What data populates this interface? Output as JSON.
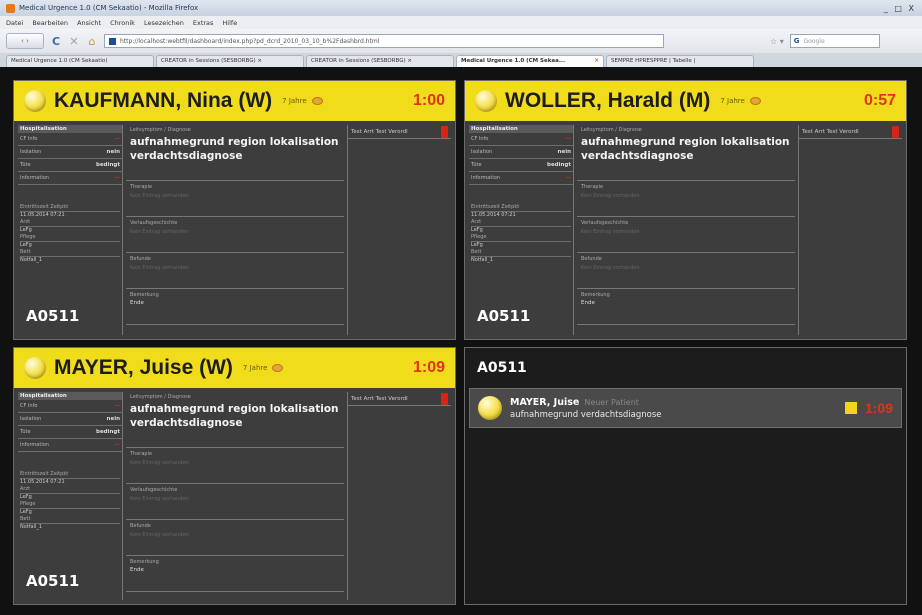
{
  "browser": {
    "title": "Medical Urgence 1.0 (CM Sekaatio) - Mozilla Firefox",
    "window_controls": "_ □ X",
    "menu": [
      "Datei",
      "Bearbeiten",
      "Ansicht",
      "Chronik",
      "Lesezeichen",
      "Extras",
      "Hilfe"
    ],
    "back_label": "‹ ›",
    "url": "http://localhost:webtfil/dashboard/index.php?pd_dcrd_2010_03_10_b%2Fdashbrd.html",
    "search_placeholder": "Google",
    "tabs": [
      {
        "label": "Medical Urgence 1.0 (CM Sekaatio)",
        "active": false
      },
      {
        "label": "CREATOR in Sessions (SESBORBG) ×",
        "active": false
      },
      {
        "label": "CREATOR in Sessions (SESBORBG) ×",
        "active": false
      },
      {
        "label": "Medical Urgence 1.0 (CM Sekaa...",
        "active": true
      },
      {
        "label": "SEMPRE HPRESPPRE | Tabelle |",
        "active": false
      }
    ]
  },
  "common": {
    "left_header": "Hospitalisation",
    "left_rows": [
      {
        "k": "CF Info",
        "v": "—"
      },
      {
        "k": "Isolation",
        "v": "nein"
      },
      {
        "k": "Tüte",
        "v": "bedingt"
      },
      {
        "k": "Information",
        "v": "—"
      }
    ],
    "small_blocks": [
      {
        "l": "Eintrittszeit Zeitpkt",
        "v": "11.05.2014 07:21"
      },
      {
        "l": "Arzt",
        "v": "LeFg"
      },
      {
        "l": "Pflege",
        "v": "LeFg"
      },
      {
        "l": "Bett",
        "v": "Notfall_1"
      }
    ],
    "mid_caption": "Leitsymptom / Diagnose",
    "diagnosis": "aufnahmegrund region lokalisation verdachtsdiagnose",
    "mid_sections": [
      {
        "cap": "Therapie",
        "ph": "Kein Eintrag vorhanden",
        "val": ""
      },
      {
        "cap": "Verlaufsgeschichte",
        "ph": "Kein Eintrag vorhanden",
        "val": ""
      },
      {
        "cap": "Befunde",
        "ph": "Kein Eintrag vorhanden",
        "val": ""
      },
      {
        "cap": "Bemerkung",
        "ph": "",
        "val": "Ende"
      }
    ],
    "right_header": "Test Arrt Test Verordl",
    "room": "A0511"
  },
  "patients": [
    {
      "name": "KAUFMANN, Nina (W)",
      "age": "7 Jahre",
      "timer": "1:00"
    },
    {
      "name": "WOLLER, Harald (M)",
      "age": "7 Jahre",
      "timer": "0:57"
    },
    {
      "name": "MAYER, Juise (W)",
      "age": "7 Jahre",
      "timer": "1:09"
    }
  ],
  "overview": {
    "room": "A0511",
    "entry_name": "MAYER, Juise",
    "entry_tag": "Neuer Patient",
    "entry_diag": "aufnahmegrund  verdachtsdiagnose",
    "entry_timer": "1:09"
  },
  "colors": {
    "header_yellow": "#f1dc1c",
    "timer_red": "#e0331b",
    "panel_bg": "#3d3d3d"
  }
}
